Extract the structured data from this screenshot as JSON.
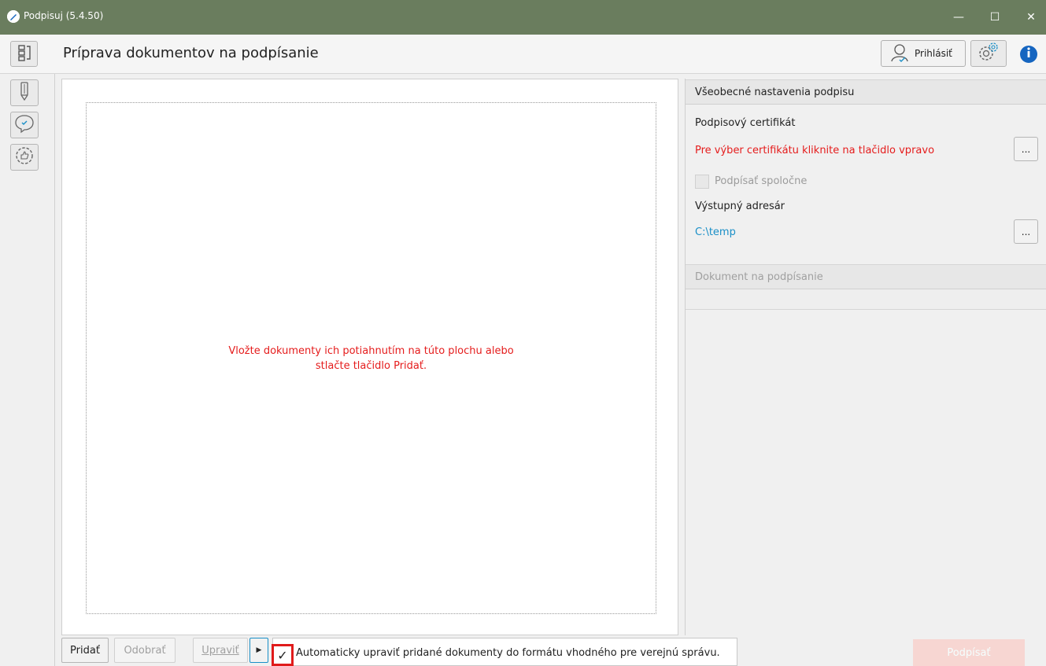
{
  "window": {
    "title": "Podpisuj (5.4.50)",
    "minimize_glyph": "—",
    "maximize_glyph": "☐",
    "close_glyph": "✕"
  },
  "header": {
    "page_title": "Príprava dokumentov na podpísanie",
    "login_label": "Prihlásiť"
  },
  "dropzone": {
    "message_line1": "Vložte dokumenty ich potiahnutím na túto plochu alebo",
    "message_line2": "stlačte tlačidlo Pridať."
  },
  "toolbar": {
    "add_label": "Pridať",
    "remove_label": "Odobrať",
    "edit_label": "Upraviť",
    "play_glyph": "▶",
    "auto_check_mark": "✓",
    "auto_check_label": "Automaticky upraviť pridané dokumenty do formátu vhodného pre verejnú správu.",
    "sign_label": "Podpísať"
  },
  "settings": {
    "section_title": "Všeobecné nastavenia podpisu",
    "cert_label": "Podpisový certifikát",
    "cert_hint": "Pre výber certifikátu kliknite na tlačidlo vpravo",
    "joint_sign_label": "Podpísať spoločne",
    "output_dir_label": "Výstupný adresár",
    "output_dir_value": "C:\\temp",
    "browse_label": "...",
    "doc_section_title": "Dokument na podpísanie"
  },
  "colors": {
    "titlebar": "#6a7d5e",
    "error_red": "#e51c1c",
    "link_blue": "#1a8fc7",
    "info_blue": "#1565c0"
  }
}
